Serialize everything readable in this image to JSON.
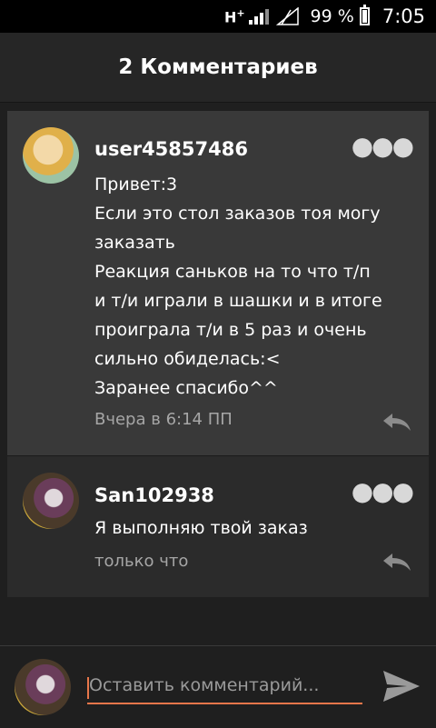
{
  "status_bar": {
    "network": "H",
    "network_sup": "+",
    "battery_percent": "99 %",
    "battery_level": 0.99,
    "time": "7:05"
  },
  "header": {
    "title": "2 Комментариев"
  },
  "comments": [
    {
      "username": "user45857486",
      "lines": [
        "Привет:3",
        "Если это стол заказов тоя могу",
        "заказать",
        "Реакция саньков на то что т/п",
        "и т/и играли в шашки и в итоге",
        "проиграла т/и в 5 раз и очень",
        "сильно обиделась:<",
        "Заранее спасибо^^"
      ],
      "time": "Вчера в 6:14 ПП",
      "more_icon": "more-dots-icon",
      "reply_icon": "reply-icon"
    },
    {
      "username": "San102938",
      "lines": [
        "Я выполняю твой заказ"
      ],
      "time": "только что",
      "more_icon": "more-dots-icon",
      "reply_icon": "reply-icon"
    }
  ],
  "composer": {
    "placeholder": "Оставить комментарий...",
    "value": "",
    "send_icon": "send-icon"
  },
  "colors": {
    "accent": "#e8764a",
    "background": "#1f1f1f",
    "card_highlight": "#393939",
    "card": "#2b2b2b"
  }
}
